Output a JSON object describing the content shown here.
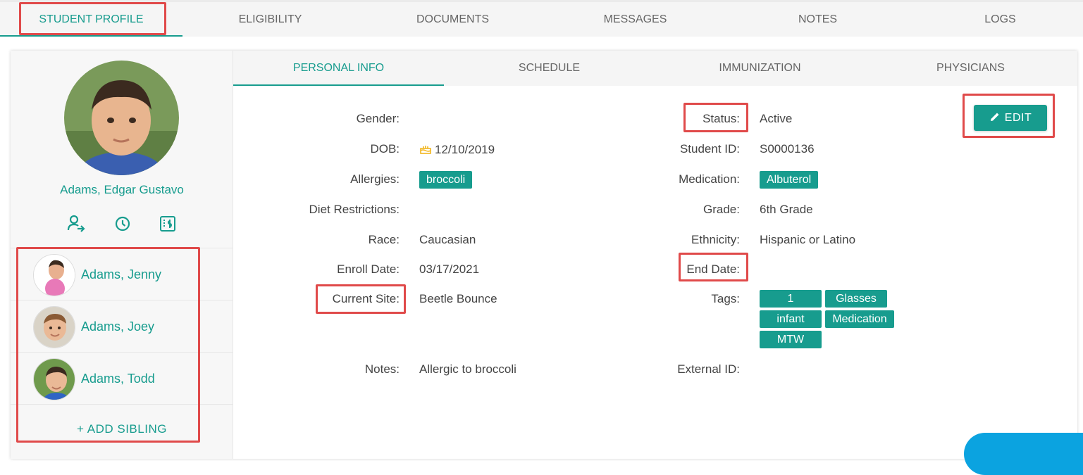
{
  "top_tabs": [
    "STUDENT PROFILE",
    "ELIGIBILITY",
    "DOCUMENTS",
    "MESSAGES",
    "NOTES",
    "LOGS"
  ],
  "inner_tabs": [
    "PERSONAL INFO",
    "SCHEDULE",
    "IMMUNIZATION",
    "PHYSICIANS"
  ],
  "student": {
    "name": "Adams, Edgar Gustavo"
  },
  "quick_icons": [
    "user-transfer-icon",
    "clock-icon",
    "billing-icon"
  ],
  "siblings": [
    {
      "name": "Adams, Jenny"
    },
    {
      "name": "Adams, Joey"
    },
    {
      "name": "Adams, Todd"
    }
  ],
  "add_sibling": "+   ADD SIBLING",
  "edit_label": "EDIT",
  "left_fields": {
    "gender": {
      "label": "Gender:",
      "value": ""
    },
    "dob": {
      "label": "DOB:",
      "value": "12/10/2019"
    },
    "allergies": {
      "label": "Allergies:",
      "value": "broccoli"
    },
    "diet": {
      "label": "Diet Restrictions:",
      "value": ""
    },
    "race": {
      "label": "Race:",
      "value": "Caucasian"
    },
    "enroll": {
      "label": "Enroll Date:",
      "value": "03/17/2021"
    },
    "site": {
      "label": "Current Site:",
      "value": "Beetle Bounce"
    },
    "notes": {
      "label": "Notes:",
      "value": "Allergic to broccoli"
    }
  },
  "right_fields": {
    "status": {
      "label": "Status:",
      "value": "Active"
    },
    "student_id": {
      "label": "Student ID:",
      "value": "S0000136"
    },
    "medication": {
      "label": "Medication:",
      "value": "Albuterol"
    },
    "grade": {
      "label": "Grade:",
      "value": "6th Grade"
    },
    "ethnicity": {
      "label": "Ethnicity:",
      "value": "Hispanic or Latino"
    },
    "end_date": {
      "label": "End Date:",
      "value": ""
    },
    "tags": {
      "label": "Tags:",
      "values": [
        "1",
        "Glasses",
        "infant",
        "Medication",
        "MTW"
      ]
    },
    "external_id": {
      "label": "External ID:",
      "value": ""
    }
  },
  "colors": {
    "accent": "#179c8e",
    "highlight": "#e04a4a"
  }
}
